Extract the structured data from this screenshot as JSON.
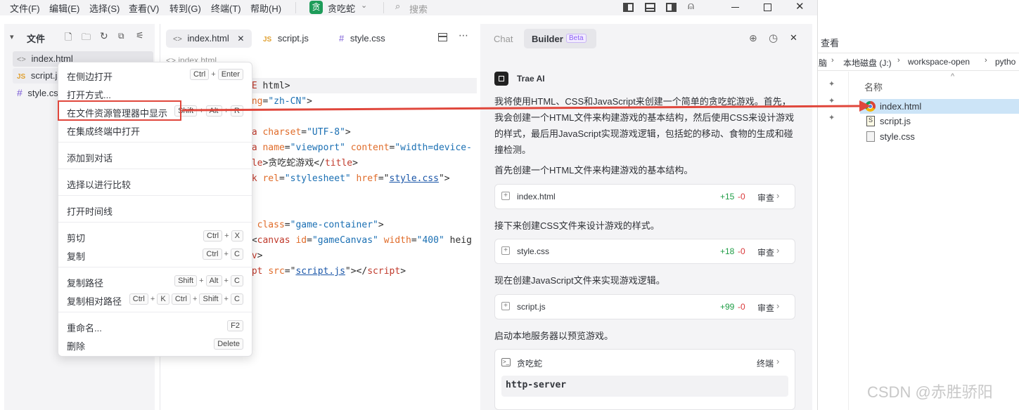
{
  "menubar": {
    "items": [
      "文件(F)",
      "编辑(E)",
      "选择(S)",
      "查看(V)",
      "转到(G)",
      "终端(T)",
      "帮助(H)"
    ],
    "project_badge": "贪",
    "project_name": "贪吃蛇",
    "search_placeholder": "搜索"
  },
  "explorer": {
    "title": "文件",
    "files": [
      "index.html",
      "script.js",
      "style.css"
    ],
    "file_icons": [
      "<>",
      "JS",
      "#"
    ]
  },
  "editor": {
    "tabs": [
      "index.html",
      "script.js",
      "style.css"
    ],
    "tab_icons": [
      "<>",
      "JS",
      "#"
    ],
    "breadcrumb": "index.html",
    "code_lines": [
      {
        "parts": [
          [
            "kw",
            "PE"
          ],
          [
            "tx",
            " html>"
          ]
        ]
      },
      {
        "parts": [
          [
            "at",
            "ang"
          ],
          [
            "tx",
            "="
          ],
          [
            "st",
            "\"zh-CN\""
          ],
          [
            "tx",
            ">"
          ]
        ]
      },
      {
        "parts": []
      },
      {
        "parts": [
          [
            "kw",
            "ta"
          ],
          [
            "tx",
            " "
          ],
          [
            "at",
            "charset"
          ],
          [
            "tx",
            "="
          ],
          [
            "st",
            "\"UTF-8\""
          ],
          [
            "tx",
            ">"
          ]
        ]
      },
      {
        "parts": [
          [
            "kw",
            "ta"
          ],
          [
            "tx",
            " "
          ],
          [
            "at",
            "name"
          ],
          [
            "tx",
            "="
          ],
          [
            "st",
            "\"viewport\""
          ],
          [
            "tx",
            " "
          ],
          [
            "at",
            "content"
          ],
          [
            "tx",
            "="
          ],
          [
            "st",
            "\"width=device-"
          ]
        ]
      },
      {
        "parts": [
          [
            "kw",
            "tle"
          ],
          [
            "tx",
            ">贪吃蛇游戏</"
          ],
          [
            "kw",
            "title"
          ],
          [
            "tx",
            ">"
          ]
        ]
      },
      {
        "parts": [
          [
            "kw",
            "nk"
          ],
          [
            "tx",
            " "
          ],
          [
            "at",
            "rel"
          ],
          [
            "tx",
            "="
          ],
          [
            "st",
            "\"stylesheet\""
          ],
          [
            "tx",
            " "
          ],
          [
            "at",
            "href"
          ],
          [
            "tx",
            "=\""
          ],
          [
            "lk",
            "style.css"
          ],
          [
            "tx",
            "\">"
          ]
        ]
      },
      {
        "parts": []
      },
      {
        "parts": []
      },
      {
        "parts": [
          [
            "tx",
            "/ "
          ],
          [
            "at",
            "class"
          ],
          [
            "tx",
            "="
          ],
          [
            "st",
            "\"game-container\""
          ],
          [
            "tx",
            ">"
          ]
        ]
      },
      {
        "parts": [
          [
            "tx",
            " <"
          ],
          [
            "kw",
            "canvas"
          ],
          [
            "tx",
            " "
          ],
          [
            "at",
            "id"
          ],
          [
            "tx",
            "="
          ],
          [
            "st",
            "\"gameCanvas\""
          ],
          [
            "tx",
            " "
          ],
          [
            "at",
            "width"
          ],
          [
            "tx",
            "="
          ],
          [
            "st",
            "\"400\""
          ],
          [
            "tx",
            " heig"
          ]
        ]
      },
      {
        "parts": [
          [
            "kw",
            "iv"
          ],
          [
            "tx",
            ">"
          ]
        ]
      },
      {
        "parts": [
          [
            "kw",
            "ipt"
          ],
          [
            "tx",
            " "
          ],
          [
            "at",
            "src"
          ],
          [
            "tx",
            "=\""
          ],
          [
            "lk",
            "script.js"
          ],
          [
            "tx",
            "\"></"
          ],
          [
            "kw",
            "script"
          ],
          [
            "tx",
            ">"
          ]
        ]
      }
    ]
  },
  "context_menu": {
    "items": [
      {
        "label": "在侧边打开",
        "keys": [
          [
            "Ctrl",
            "Enter"
          ]
        ]
      },
      {
        "label": "打开方式...",
        "keys": []
      },
      {
        "label": "在文件资源管理器中显示",
        "keys": [
          [
            "Shift",
            "Alt",
            "R"
          ]
        ]
      },
      {
        "label": "在集成终端中打开",
        "keys": []
      },
      {
        "label": "添加到对话",
        "keys": []
      },
      {
        "label": "选择以进行比较",
        "keys": []
      },
      {
        "label": "打开时间线",
        "keys": []
      },
      {
        "label": "剪切",
        "keys": [
          [
            "Ctrl",
            "X"
          ]
        ]
      },
      {
        "label": "复制",
        "keys": [
          [
            "Ctrl",
            "C"
          ]
        ]
      },
      {
        "label": "复制路径",
        "keys": [
          [
            "Shift",
            "Alt",
            "C"
          ]
        ]
      },
      {
        "label": "复制相对路径",
        "keys": [
          [
            "Ctrl",
            "K"
          ],
          [
            "Ctrl",
            "Shift",
            "C"
          ]
        ]
      },
      {
        "label": "重命名...",
        "keys": [
          [
            "F2"
          ]
        ]
      },
      {
        "label": "删除",
        "keys": [
          [
            "Delete"
          ]
        ]
      }
    ],
    "highlight_color": "#e0473c"
  },
  "chat": {
    "tab_chat": "Chat",
    "tab_builder": "Builder",
    "beta_badge": "Beta",
    "assistant_name": "Trae AI",
    "intro": "我将使用HTML、CSS和JavaScript来创建一个简单的贪吃蛇游戏。首先，我会创建一个HTML文件来构建游戏的基本结构，然后使用CSS来设计游戏的样式，最后用JavaScript实现游戏逻辑，包括蛇的移动、食物的生成和碰撞检测。",
    "steps": [
      {
        "text": "首先创建一个HTML文件来构建游戏的基本结构。",
        "file": "index.html",
        "added": "+15",
        "removed": "-0",
        "action": "审查"
      },
      {
        "text": "接下来创建CSS文件来设计游戏的样式。",
        "file": "style.css",
        "added": "+18",
        "removed": "-0",
        "action": "审查"
      },
      {
        "text": "现在创建JavaScript文件来实现游戏逻辑。",
        "file": "script.js",
        "added": "+99",
        "removed": "-0",
        "action": "审查"
      }
    ],
    "server_text": "启动本地服务器以预览游戏。",
    "terminal_name": "贪吃蛇",
    "terminal_action": "终端",
    "command": "http-server"
  },
  "windows_explorer": {
    "menu": "查看",
    "breadcrumb": [
      "脑",
      "本地磁盘 (J:)",
      "workspace-open",
      "pytho"
    ],
    "column_header": "名称",
    "files": [
      "index.html",
      "script.js",
      "style.css"
    ]
  },
  "watermark": "CSDN @赤胜骄阳",
  "colors": {
    "accent": "#1e9c45",
    "annotation_red": "#e0473c",
    "beta": "#8a5cf6"
  }
}
